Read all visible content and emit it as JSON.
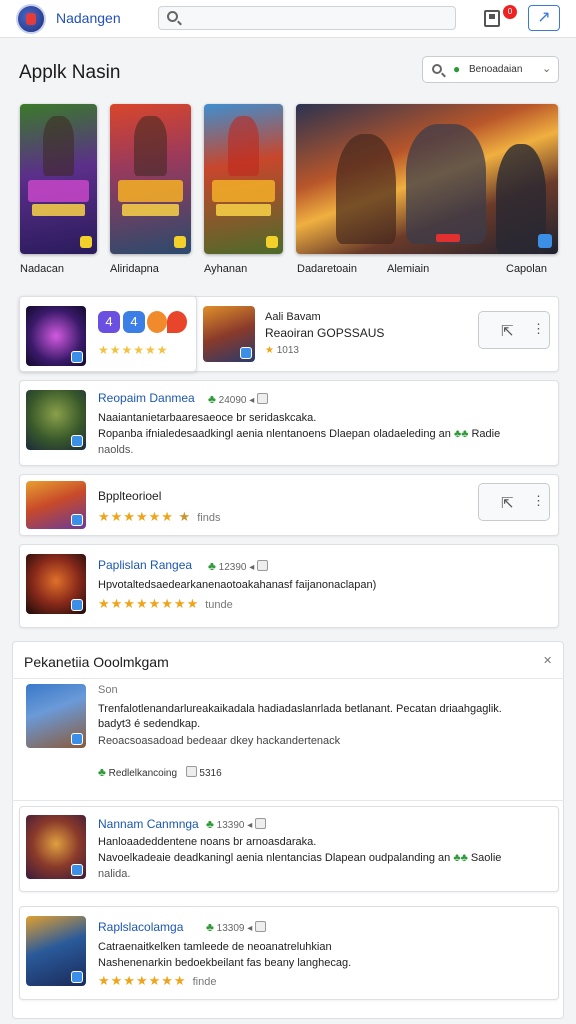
{
  "header": {
    "app_name": "Nadangen",
    "notification_count": "0",
    "share_icon": "share-icon"
  },
  "section": {
    "title": "Applk Nasin",
    "filter_label": "Benoadaian"
  },
  "covers": [
    {
      "label": "Nadacan"
    },
    {
      "label": "Aliridapna"
    },
    {
      "label": "Ayhanan"
    },
    {
      "label": "Dadaretoain"
    },
    {
      "label": "Alemiain"
    },
    {
      "label": "Capolan"
    }
  ],
  "list": {
    "card1": {
      "rating_left": "★★★★★★",
      "title": "Aali Bavam",
      "subtitle": "Reaoiran GOPSSAUS",
      "meta": "1013"
    },
    "card2": {
      "title": "Reopaim Danmea",
      "meta": "24090",
      "desc1": "Naaiantanietarbaaresaeoce br seridaskcaka.",
      "desc2": "Ropanba ifnialedesaadkingl aenia nlentanoens Dlaepan oladaeleding an",
      "desc2_tail": "Radie",
      "desc3": "naolds."
    },
    "card3": {
      "title": "Bpplteorioel",
      "rating_text": "finds"
    },
    "card4": {
      "title": "Paplislan Rangea",
      "meta": "12390",
      "desc": "Hpvotaltedsaedearkanenaotoakahanasf faijanonaclapan)",
      "rating_text": "tunde"
    }
  },
  "recommendations": {
    "title": "Pekanetiia Ooolmkgam",
    "item1": {
      "label": "Son",
      "desc1": "Trenfalotlenandarlureakaikadala hadiadaslanrlada betlanant. Pecatan driaahgaglik.",
      "desc2": "badyt3 é sedendkap.",
      "desc3": "Reoacsoasadoad bedeaar dkey hackandertenack",
      "footer": "Redlelkancoing",
      "footer_count": "5316"
    },
    "item2": {
      "title": "Nannam Canmnga",
      "meta": "13390",
      "desc1": "Hanloaadeddentene noans br arnoasdaraka.",
      "desc2": "Navoelkadeaie deadkaningl aenia nlentancias Dlapean oudpalanding an",
      "desc2_tail": "Saolie",
      "desc3": "nalida."
    },
    "item3": {
      "title": "Raplslacolamga",
      "meta": "13309",
      "desc1": "Catraenaitkelken tamleede de neoanatreluhkian",
      "desc2": "Nashenenarkin bedoekbeilant fas beany langhecag.",
      "rating_text": "finde"
    }
  },
  "colors": {
    "link": "#1d57b0",
    "star": "#f0a41a",
    "accent": "#3a78d6",
    "leaf": "#2f9a38"
  }
}
